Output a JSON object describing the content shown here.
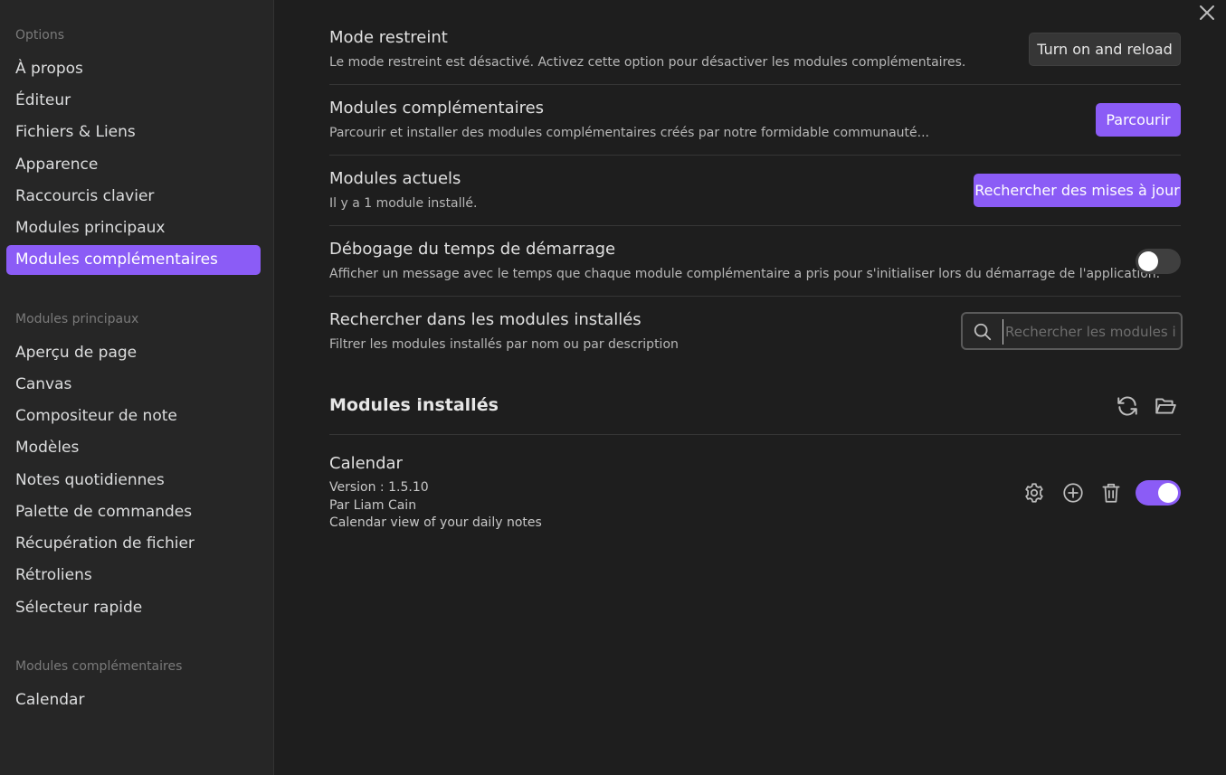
{
  "sidebar": {
    "sections": [
      {
        "title": "Options",
        "items": [
          "À propos",
          "Éditeur",
          "Fichiers & Liens",
          "Apparence",
          "Raccourcis clavier",
          "Modules principaux",
          "Modules complémentaires"
        ]
      },
      {
        "title": "Modules principaux",
        "items": [
          "Aperçu de page",
          "Canvas",
          "Compositeur de note",
          "Modèles",
          "Notes quotidiennes",
          "Palette de commandes",
          "Récupération de fichier",
          "Rétroliens",
          "Sélecteur rapide"
        ]
      },
      {
        "title": "Modules complémentaires",
        "items": [
          "Calendar"
        ]
      }
    ],
    "active_item": "Modules complémentaires"
  },
  "settings": {
    "restricted": {
      "name": "Mode restreint",
      "desc": "Le mode restreint est désactivé. Activez cette option pour désactiver les modules complémentaires.",
      "button": "Turn on and reload"
    },
    "community": {
      "name": "Modules complémentaires",
      "desc": "Parcourir et installer des modules complémentaires créés par notre formidable communauté...",
      "button": "Parcourir"
    },
    "current": {
      "name": "Modules actuels",
      "desc": "Il y a 1 module installé.",
      "button": "Rechercher des mises à jour"
    },
    "debug": {
      "name": "Débogage du temps de démarrage",
      "desc": "Afficher un message avec le temps que chaque module complémentaire a pris pour s'initialiser lors du démarrage de l'application.",
      "enabled": false
    },
    "search": {
      "name": "Rechercher dans les modules installés",
      "desc": "Filtrer les modules installés par nom ou par description",
      "placeholder": "Rechercher les modules installés...",
      "value": ""
    }
  },
  "installed": {
    "heading": "Modules installés",
    "plugins": [
      {
        "name": "Calendar",
        "version": "Version : 1.5.10",
        "author": "Par Liam Cain",
        "description": "Calendar view of your daily notes",
        "enabled": true
      }
    ]
  },
  "colors": {
    "accent": "#8b5cf6",
    "background": "#1e1e1e",
    "sidebar": "#262626"
  },
  "icons": [
    "close-icon",
    "search-icon",
    "refresh-icon",
    "folder-open-icon",
    "gear-icon",
    "plus-circle-icon",
    "trash-icon"
  ]
}
